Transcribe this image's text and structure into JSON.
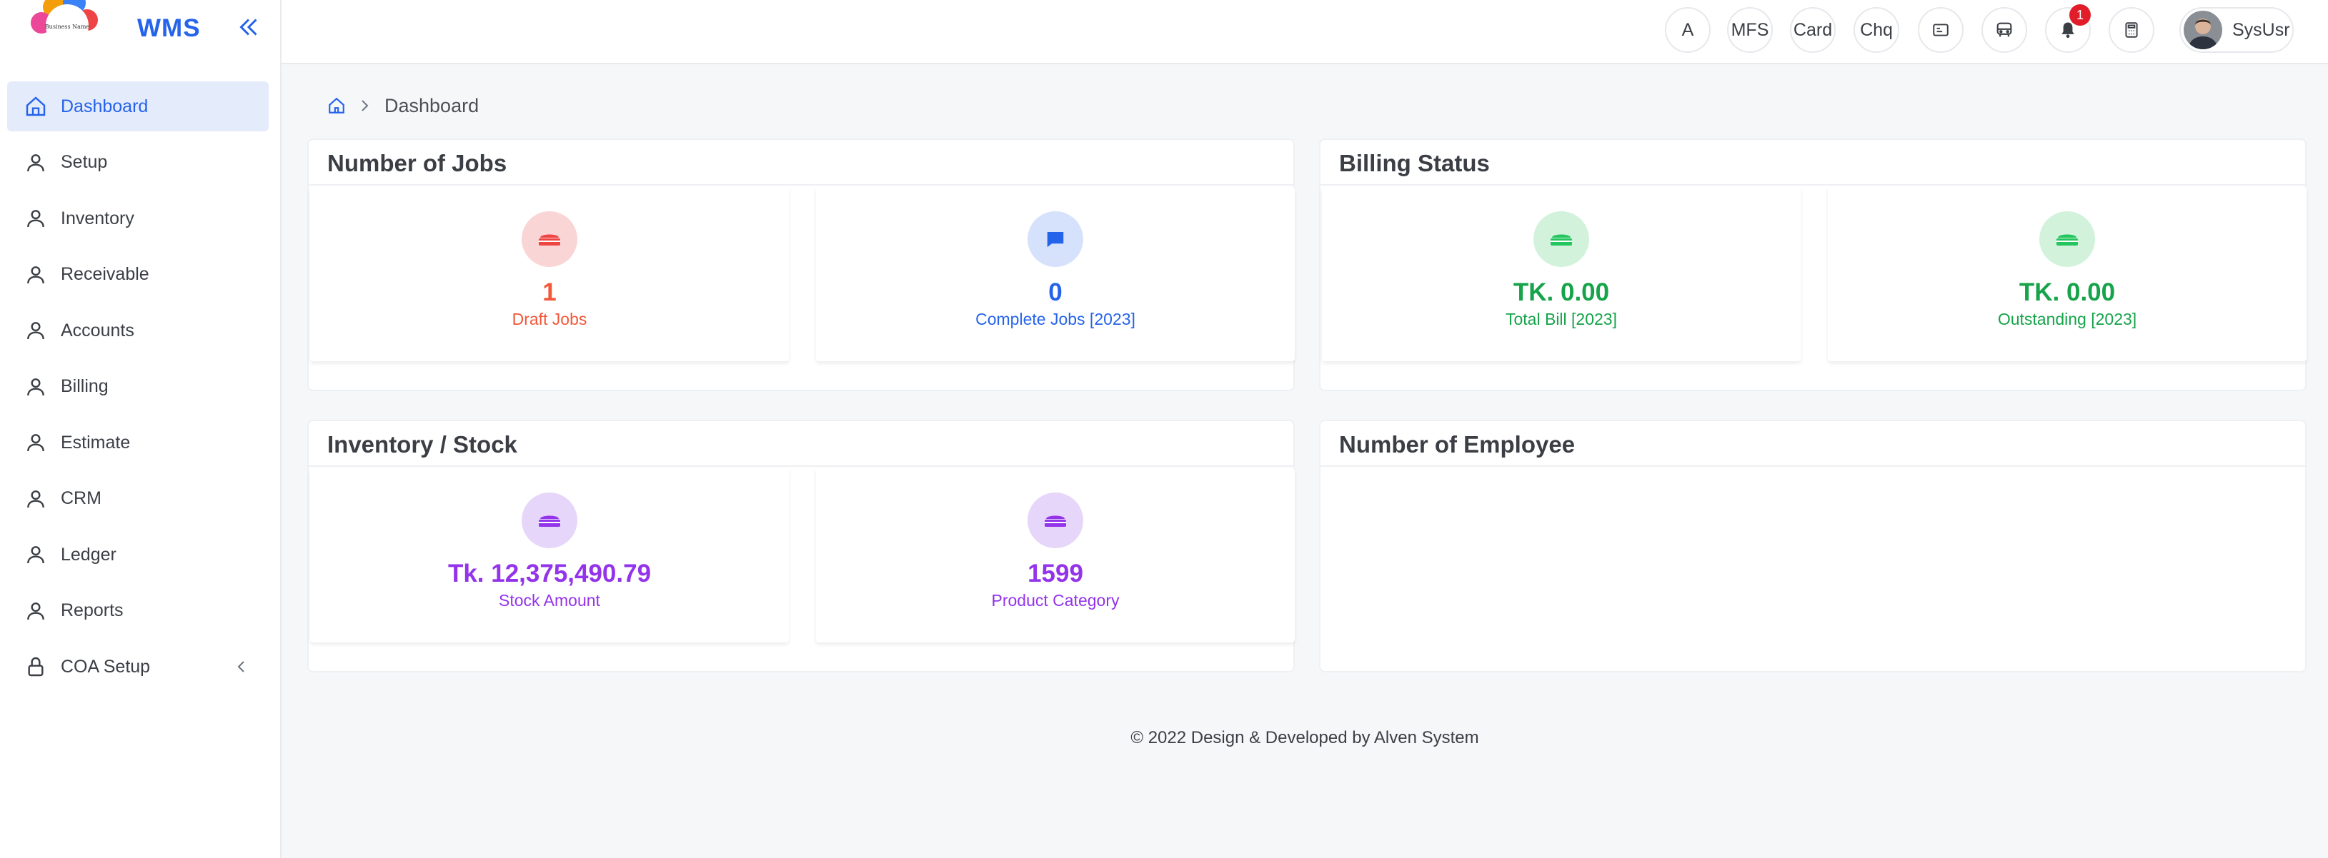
{
  "app": {
    "brand": "WMS",
    "logo_text": "Business Name"
  },
  "sidebar": {
    "items": [
      {
        "label": "Dashboard",
        "icon": "home-icon",
        "active": true
      },
      {
        "label": "Setup",
        "icon": "user-icon"
      },
      {
        "label": "Inventory",
        "icon": "user-icon"
      },
      {
        "label": "Receivable",
        "icon": "user-icon"
      },
      {
        "label": "Accounts",
        "icon": "user-icon"
      },
      {
        "label": "Billing",
        "icon": "user-icon"
      },
      {
        "label": "Estimate",
        "icon": "user-icon"
      },
      {
        "label": "CRM",
        "icon": "user-icon"
      },
      {
        "label": "Ledger",
        "icon": "user-icon"
      },
      {
        "label": "Reports",
        "icon": "user-icon"
      },
      {
        "label": "COA Setup",
        "icon": "lock-icon",
        "has_submenu": true
      }
    ]
  },
  "topbar": {
    "a_label": "A",
    "mfs_label": "MFS",
    "card_label": "Card",
    "chq_label": "Chq",
    "notification_count": "1",
    "user_name": "SysUsr"
  },
  "breadcrumb": {
    "current": "Dashboard"
  },
  "panels": {
    "jobs": {
      "title": "Number of Jobs",
      "stats": [
        {
          "value": "1",
          "label": "Draft Jobs",
          "color": "#f2573a",
          "bg": "#f9d5d5",
          "icon": "briefcase-icon",
          "icon_color": "#ef4444"
        },
        {
          "value": "0",
          "label": "Complete Jobs [2023]",
          "color": "#2563eb",
          "bg": "#d6e2fb",
          "icon": "chat-icon",
          "icon_color": "#2563eb"
        }
      ]
    },
    "billing": {
      "title": "Billing Status",
      "stats": [
        {
          "value": "TK. 0.00",
          "label": "Total Bill [2023]",
          "color": "#16a34a",
          "bg": "#d2f2dc",
          "icon": "briefcase-icon",
          "icon_color": "#22c55e"
        },
        {
          "value": "TK. 0.00",
          "label": "Outstanding [2023]",
          "color": "#16a34a",
          "bg": "#d2f2dc",
          "icon": "briefcase-icon",
          "icon_color": "#22c55e"
        }
      ]
    },
    "inventory": {
      "title": "Inventory / Stock",
      "stats": [
        {
          "value": "Tk. 12,375,490.79",
          "label": "Stock Amount",
          "color": "#9333ea",
          "bg": "#e6d6f9",
          "icon": "briefcase-icon",
          "icon_color": "#9333ea"
        },
        {
          "value": "1599",
          "label": "Product Category",
          "color": "#9333ea",
          "bg": "#e6d6f9",
          "icon": "briefcase-icon",
          "icon_color": "#9333ea"
        }
      ]
    },
    "employee": {
      "title": "Number of Employee"
    }
  },
  "footer": {
    "text": "© 2022 Design & Developed by Alven System"
  }
}
